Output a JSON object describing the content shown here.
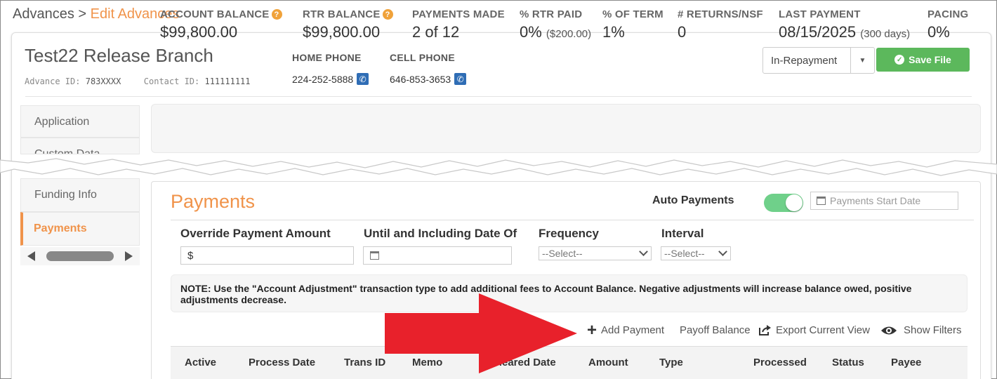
{
  "breadcrumb": {
    "parent": "Advances",
    "separator": ">",
    "current": "Edit Advances"
  },
  "header": {
    "title": "Test22 Release Branch",
    "advance_id_label": "Advance ID:",
    "advance_id": "783XXXX",
    "contact_id_label": "Contact ID:",
    "contact_id": "111111111",
    "home_phone_label": "HOME PHONE",
    "home_phone": "224-252-5888",
    "cell_phone_label": "CELL PHONE",
    "cell_phone": "646-853-3653",
    "status": "In-Repayment",
    "save_label": "Save File"
  },
  "sidebar": {
    "items": [
      {
        "label": "Application"
      },
      {
        "label": "Custom Data"
      },
      {
        "label": "Funding Info"
      },
      {
        "label": "Payments",
        "active": true
      }
    ]
  },
  "stats": [
    {
      "label": "ACCOUNT BALANCE",
      "value": "$99,800.00",
      "help": true
    },
    {
      "label": "RTR BALANCE",
      "value": "$99,800.00",
      "help": true
    },
    {
      "label": "PAYMENTS MADE",
      "value": "2 of 12"
    },
    {
      "label": "% RTR PAID",
      "value": "0%",
      "sub": "($200.00)"
    },
    {
      "label": "% OF TERM",
      "value": "1%"
    },
    {
      "label": "# RETURNS/NSF",
      "value": "0"
    },
    {
      "label": "LAST PAYMENT",
      "value": "08/15/2025",
      "sub": "(300 days)"
    },
    {
      "label": "PACING",
      "value": "0%"
    }
  ],
  "payments": {
    "title": "Payments",
    "auto_payments_label": "Auto Payments",
    "auto_payments_on": true,
    "start_date_placeholder": "Payments Start Date",
    "override_label": "Override Payment Amount",
    "override_prefix": "$",
    "until_label": "Until and Including Date Of",
    "frequency_label": "Frequency",
    "frequency_value": "--Select--",
    "interval_label": "Interval",
    "interval_value": "--Select--",
    "note": "NOTE: Use the \"Account Adjustment\" transaction type to add additional fees to Account Balance. Negative adjustments will increase balance owed, positive adjustments decrease.",
    "actions": {
      "add_payment": "Add Payment",
      "payoff_balance": "Payoff Balance",
      "export_view": "Export Current View",
      "show_filters": "Show Filters"
    },
    "columns": [
      "Active",
      "Process Date",
      "Trans ID",
      "Memo",
      "Cleared Date",
      "Amount",
      "Type",
      "Processed",
      "Status",
      "Payee"
    ]
  },
  "colors": {
    "accent": "#f0934a",
    "save_green": "#5cb85c",
    "toggle_on": "#6fd08a",
    "annotation_arrow": "#e8212b"
  }
}
